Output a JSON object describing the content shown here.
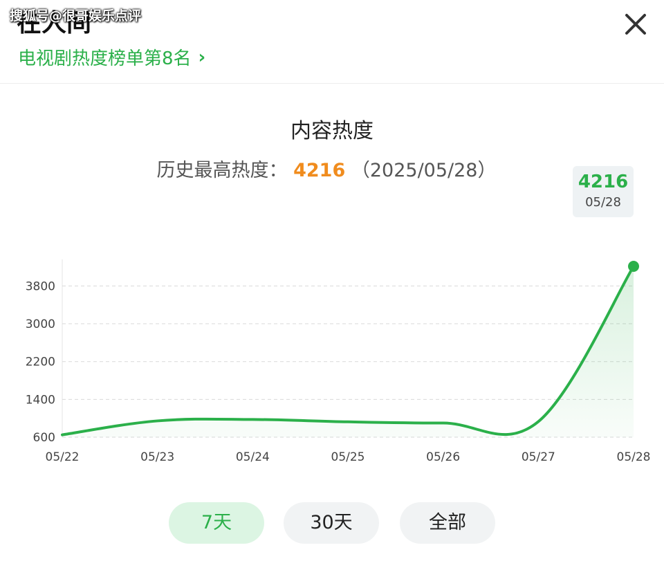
{
  "watermark": "搜狐号@很哥娱乐点评",
  "header": {
    "show_title": "在人间",
    "rank_text": "电视剧热度榜单第8名",
    "rank_chevron": "›"
  },
  "colors": {
    "accent": "#2bb04a",
    "peak": "#f08c1e"
  },
  "chart_data": {
    "type": "area",
    "title": "内容热度",
    "peak_label": "历史最高热度：",
    "peak_value": "4216",
    "peak_date": "（2025/05/28）",
    "x": [
      "05/22",
      "05/23",
      "05/24",
      "05/25",
      "05/26",
      "05/27",
      "05/28"
    ],
    "y": [
      650,
      945,
      975,
      925,
      900,
      930,
      4216
    ],
    "yticks": [
      600,
      1400,
      2200,
      3000,
      3800
    ],
    "ylim": [
      600,
      4216
    ],
    "grid": true,
    "tooltip": {
      "value": "4216",
      "date": "05/28"
    }
  },
  "range_tabs": [
    {
      "label": "7天",
      "active": true
    },
    {
      "label": "30天",
      "active": false
    },
    {
      "label": "全部",
      "active": false
    }
  ]
}
